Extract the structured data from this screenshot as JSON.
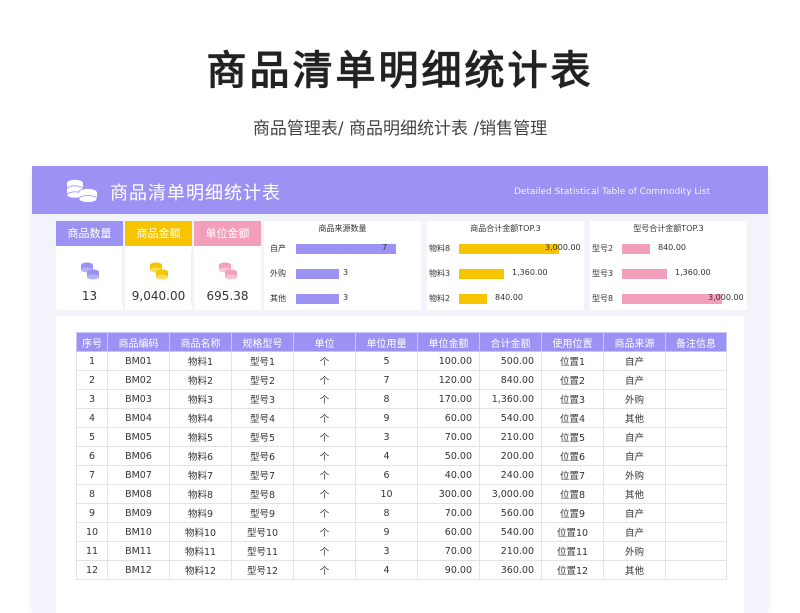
{
  "page": {
    "title": "商品清单明细统计表",
    "subtitle": "商品管理表/ 商品明细统计表 /销售管理"
  },
  "banner": {
    "title": "商品清单明细统计表",
    "subtitle_en": "Detailed Statistical Table of Commodity List"
  },
  "kpis": [
    {
      "label": "商品数量",
      "value": "13",
      "color": "#9b92f3",
      "icon": "coins-icon"
    },
    {
      "label": "商品金额",
      "value": "9,040.00",
      "color": "#f7c400",
      "icon": "coins-icon"
    },
    {
      "label": "单位金额",
      "value": "695.38",
      "color": "#f29fbc",
      "icon": "coins-icon"
    }
  ],
  "panels": [
    {
      "title": "商品来源数量",
      "color": "#9b92f3",
      "max": 7,
      "rows": [
        {
          "label": "自产",
          "value": 7,
          "display": "7"
        },
        {
          "label": "外购",
          "value": 3,
          "display": "3"
        },
        {
          "label": "其他",
          "value": 3,
          "display": "3"
        }
      ]
    },
    {
      "title": "商品合计金额TOP.3",
      "color": "#f7c400",
      "max": 3000,
      "rows": [
        {
          "label": "物料8",
          "value": 3000,
          "display": "3,000.00"
        },
        {
          "label": "物料3",
          "value": 1360,
          "display": "1,360.00"
        },
        {
          "label": "物料2",
          "value": 840,
          "display": "840.00"
        }
      ]
    },
    {
      "title": "型号合计金额TOP.3",
      "color": "#f29fbc",
      "max": 3000,
      "rows": [
        {
          "label": "型号2",
          "value": 840,
          "display": "840.00"
        },
        {
          "label": "型号3",
          "value": 1360,
          "display": "1,360.00"
        },
        {
          "label": "型号8",
          "value": 3000,
          "display": "3,000.00"
        }
      ]
    }
  ],
  "table": {
    "headers": [
      "序号",
      "商品编码",
      "商品名称",
      "规格型号",
      "单位",
      "单位用量",
      "单位金额",
      "合计金额",
      "使用位置",
      "商品来源",
      "备注信息"
    ],
    "rows": [
      [
        "1",
        "BM01",
        "物料1",
        "型号1",
        "个",
        "5",
        "100.00",
        "500.00",
        "位置1",
        "自产",
        ""
      ],
      [
        "2",
        "BM02",
        "物料2",
        "型号2",
        "个",
        "7",
        "120.00",
        "840.00",
        "位置2",
        "自产",
        ""
      ],
      [
        "3",
        "BM03",
        "物料3",
        "型号3",
        "个",
        "8",
        "170.00",
        "1,360.00",
        "位置3",
        "外购",
        ""
      ],
      [
        "4",
        "BM04",
        "物料4",
        "型号4",
        "个",
        "9",
        "60.00",
        "540.00",
        "位置4",
        "其他",
        ""
      ],
      [
        "5",
        "BM05",
        "物料5",
        "型号5",
        "个",
        "3",
        "70.00",
        "210.00",
        "位置5",
        "自产",
        ""
      ],
      [
        "6",
        "BM06",
        "物料6",
        "型号6",
        "个",
        "4",
        "50.00",
        "200.00",
        "位置6",
        "自产",
        ""
      ],
      [
        "7",
        "BM07",
        "物料7",
        "型号7",
        "个",
        "6",
        "40.00",
        "240.00",
        "位置7",
        "外购",
        ""
      ],
      [
        "8",
        "BM08",
        "物料8",
        "型号8",
        "个",
        "10",
        "300.00",
        "3,000.00",
        "位置8",
        "其他",
        ""
      ],
      [
        "9",
        "BM09",
        "物料9",
        "型号9",
        "个",
        "8",
        "70.00",
        "560.00",
        "位置9",
        "自产",
        ""
      ],
      [
        "10",
        "BM10",
        "物料10",
        "型号10",
        "个",
        "9",
        "60.00",
        "540.00",
        "位置10",
        "自产",
        ""
      ],
      [
        "11",
        "BM11",
        "物料11",
        "型号11",
        "个",
        "3",
        "70.00",
        "210.00",
        "位置11",
        "外购",
        ""
      ],
      [
        "12",
        "BM12",
        "物料12",
        "型号12",
        "个",
        "4",
        "90.00",
        "360.00",
        "位置12",
        "其他",
        ""
      ]
    ]
  }
}
